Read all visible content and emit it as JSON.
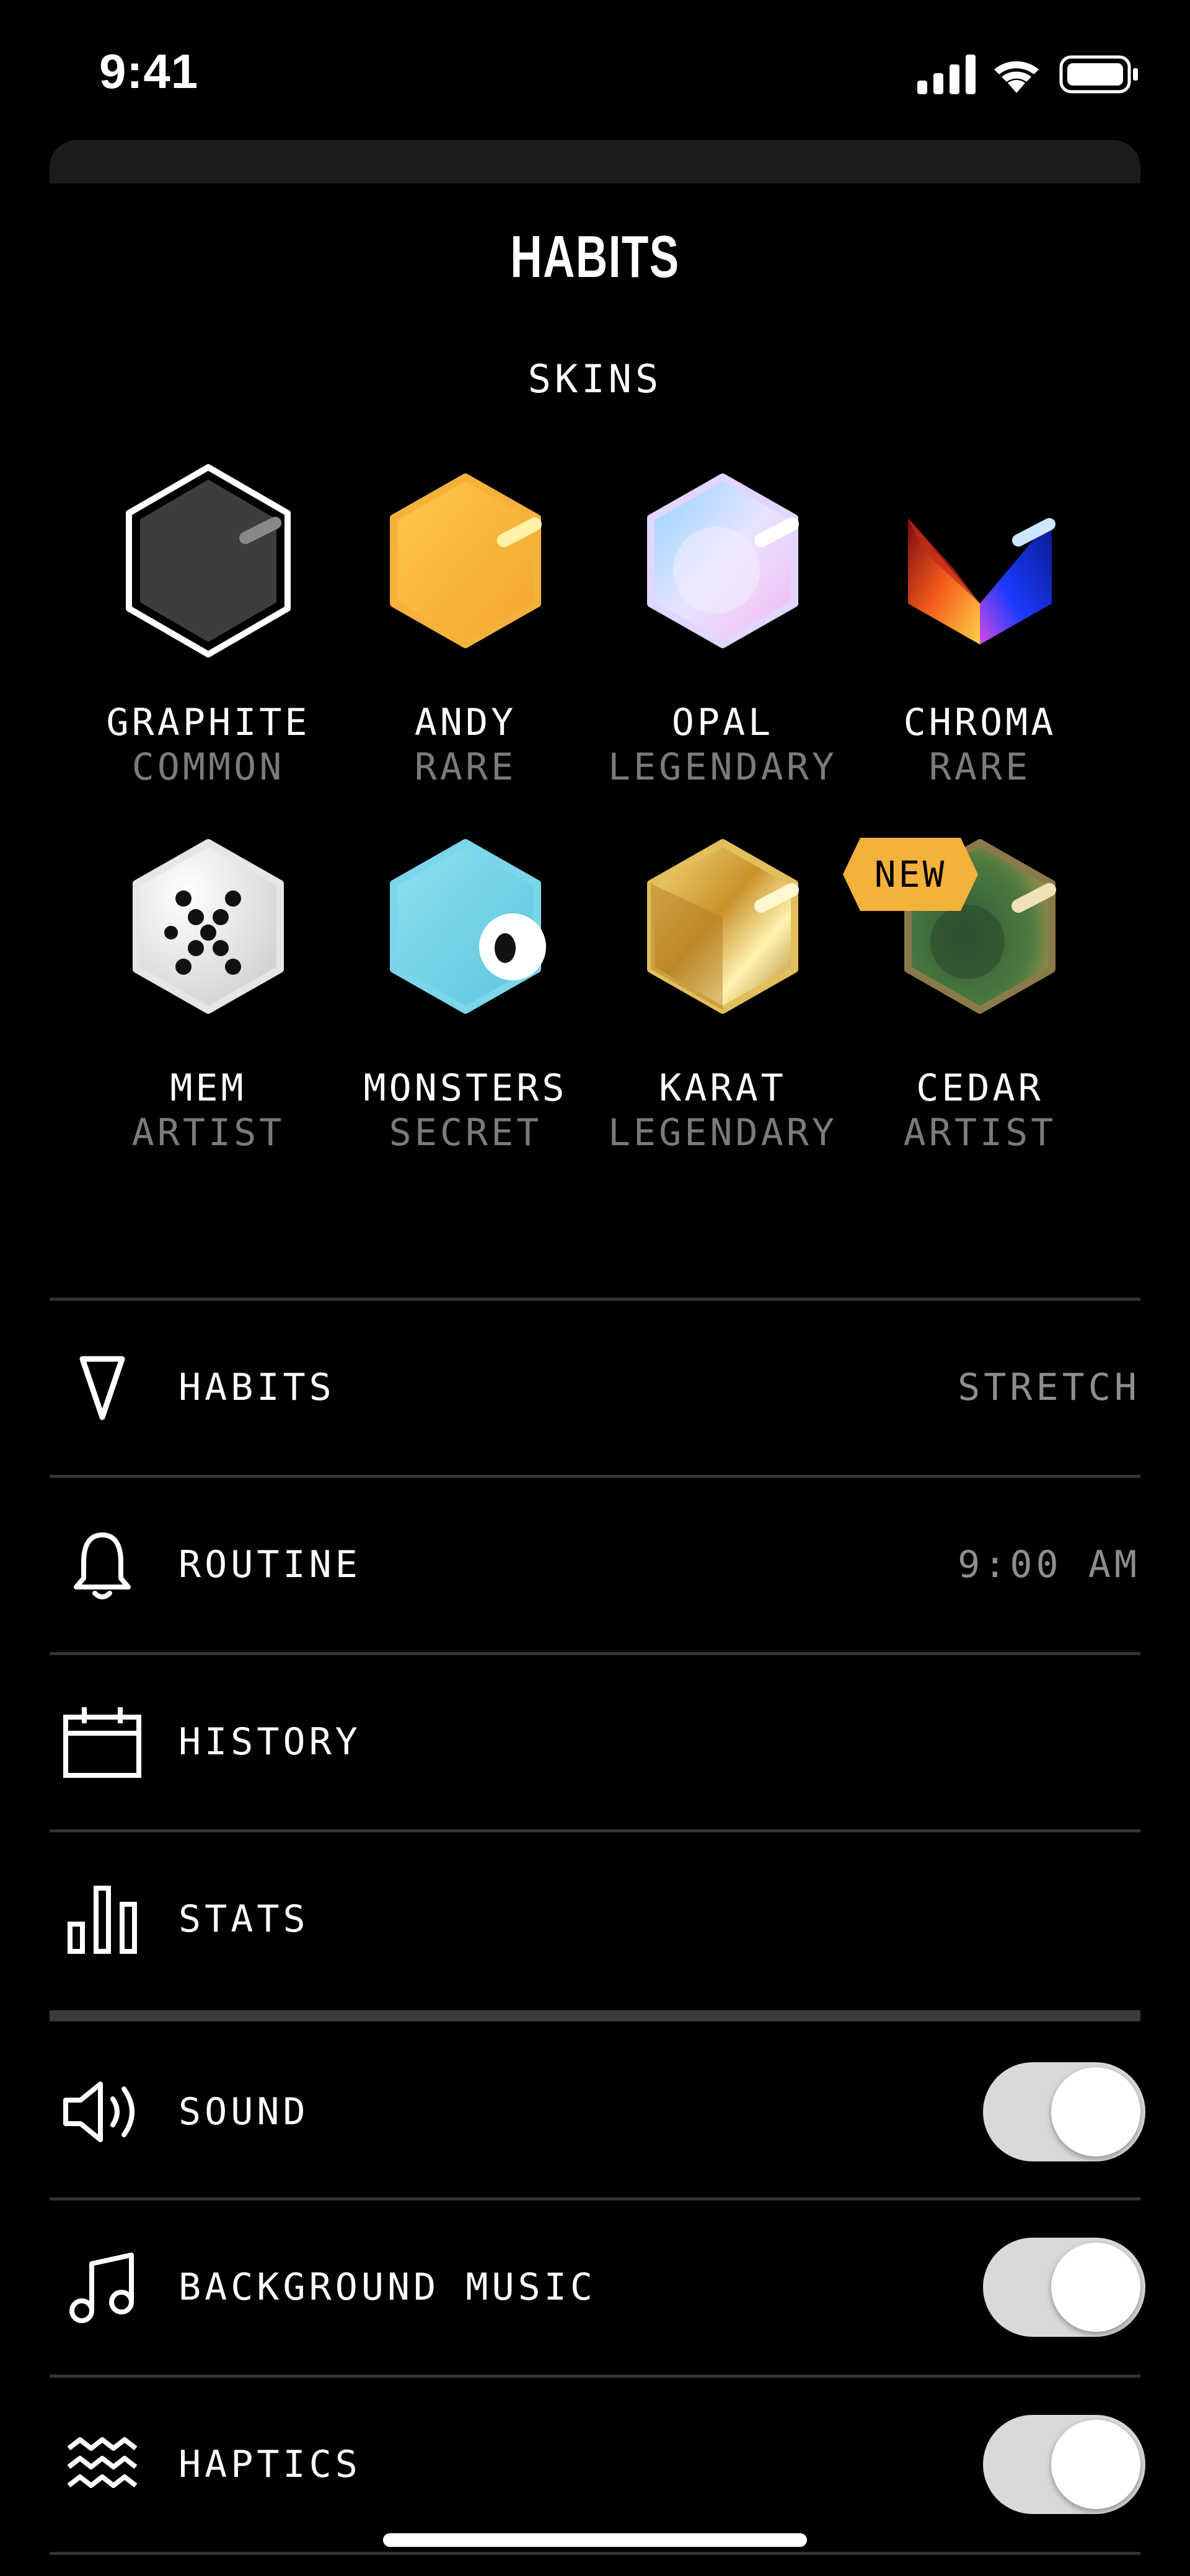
{
  "status_bar": {
    "time": "9:41"
  },
  "title": "HABITS",
  "subtitle": "SKINS",
  "skins": [
    {
      "name": "GRAPHITE",
      "rarity": "COMMON",
      "selected": true
    },
    {
      "name": "ANDY",
      "rarity": "RARE"
    },
    {
      "name": "OPAL",
      "rarity": "LEGENDARY"
    },
    {
      "name": "CHROMA",
      "rarity": "RARE"
    },
    {
      "name": "MEM",
      "rarity": "ARTIST"
    },
    {
      "name": "MONSTERS",
      "rarity": "SECRET"
    },
    {
      "name": "KARAT",
      "rarity": "LEGENDARY"
    },
    {
      "name": "CEDAR",
      "rarity": "ARTIST",
      "badge": "NEW"
    }
  ],
  "menu": [
    {
      "icon": "triangle-icon",
      "label": "HABITS",
      "value": "STRETCH"
    },
    {
      "icon": "bell-icon",
      "label": "ROUTINE",
      "value": "9:00 AM"
    },
    {
      "icon": "calendar-icon",
      "label": "HISTORY"
    },
    {
      "icon": "bar-chart-icon",
      "label": "STATS"
    }
  ],
  "toggles": [
    {
      "icon": "speaker-icon",
      "label": "SOUND",
      "on": true
    },
    {
      "icon": "music-note-icon",
      "label": "BACKGROUND MUSIC",
      "on": true
    },
    {
      "icon": "waves-icon",
      "label": "HAPTICS",
      "on": true
    }
  ],
  "colors": {
    "background": "#000000",
    "secondary_text": "#7b7b7b",
    "badge": "#f5b23a",
    "toggle_track": "#d9d9d9"
  }
}
